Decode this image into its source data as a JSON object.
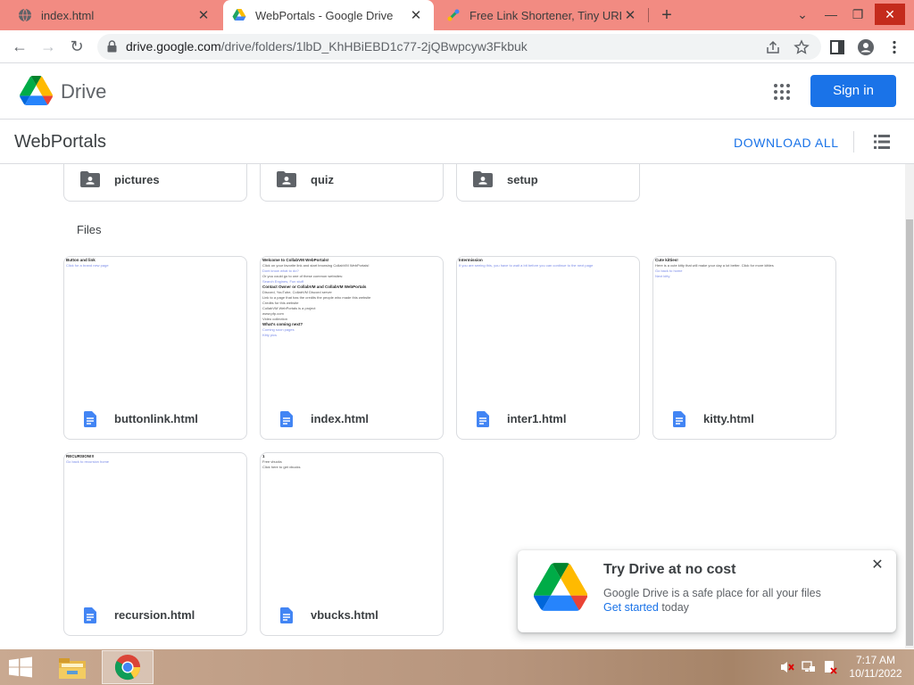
{
  "browser": {
    "tabs": [
      {
        "title": "index.html",
        "icon": "globe-icon",
        "active": false
      },
      {
        "title": "WebPortals - Google Drive",
        "icon": "drive-icon",
        "active": true
      },
      {
        "title": "Free Link Shortener, Tiny URL - n",
        "icon": "tinyurl-icon",
        "active": false
      }
    ],
    "new_tab": "+",
    "url_host": "drive.google.com",
    "url_path": "/drive/folders/1lbD_KhHBiEBD1c77-2jQBwpcyw3Fkbuk",
    "tab_close_glyph": "✕"
  },
  "drive": {
    "app_name": "Drive",
    "sign_in_label": "Sign in",
    "folder_title": "WebPortals",
    "download_all_label": "DOWNLOAD ALL",
    "files_section_label": "Files",
    "accent_color": "#1a73e8",
    "folders": [
      {
        "name": "pictures"
      },
      {
        "name": "quiz"
      },
      {
        "name": "setup"
      }
    ],
    "files": [
      {
        "name": "buttonlink.html",
        "preview": [
          {
            "t": "Button and link",
            "k": "h"
          },
          {
            "t": "Click for a brand new page",
            "k": "link"
          }
        ]
      },
      {
        "name": "index.html",
        "preview": [
          {
            "t": "Welcome to CollabVM WebPortals!",
            "k": "h"
          },
          {
            "t": "Click on your favorite link and start browsing CollabVM WebPortals!",
            "k": ""
          },
          {
            "t": "Dont know what to do?",
            "k": "link"
          },
          {
            "t": "Or you could go to one of these common websites:",
            "k": ""
          },
          {
            "t": "Search Engines, Fun stuff",
            "k": "link"
          },
          {
            "t": "Contact Owner or CollabVM and CollabVM WebPortals",
            "k": "h"
          },
          {
            "t": "Discord, YouTube, CollabVM Discord server",
            "k": ""
          },
          {
            "t": "Link to a page that has the credits the people who made this website",
            "k": ""
          },
          {
            "t": "Credits for this website",
            "k": ""
          },
          {
            "t": "CollabVM WebPortals is a project",
            "k": ""
          },
          {
            "t": "www.pfp.com",
            "k": ""
          },
          {
            "t": "Video collection",
            "k": ""
          },
          {
            "t": "What's coming next?",
            "k": "h"
          },
          {
            "t": "Coming soon pages",
            "k": "link"
          },
          {
            "t": "Kitty pics",
            "k": "link"
          }
        ]
      },
      {
        "name": "inter1.html",
        "preview": [
          {
            "t": "Intermission",
            "k": "h"
          },
          {
            "t": "If you are seeing this, you have to wait a bit before you can continue to the next page",
            "k": "link"
          }
        ]
      },
      {
        "name": "kitty.html",
        "preview": [
          {
            "t": "Cute kitties!",
            "k": "h"
          },
          {
            "t": "Here is a cute kitty that will make your day a lot better. Click for more kitties",
            "k": ""
          },
          {
            "t": "Go back to home",
            "k": "link"
          },
          {
            "t": "Next kitty",
            "k": "link"
          }
        ]
      },
      {
        "name": "recursion.html",
        "preview": [
          {
            "t": "RECURSION!!!",
            "k": "h"
          },
          {
            "t": "Go back to recursion home",
            "k": "link"
          }
        ]
      },
      {
        "name": "vbucks.html",
        "preview": [
          {
            "t": "1",
            "k": "h"
          },
          {
            "t": "Free vbucks",
            "k": ""
          },
          {
            "t": "Click here to get vbucks",
            "k": ""
          }
        ]
      }
    ],
    "promo": {
      "title": "Try Drive at no cost",
      "body": "Google Drive is a safe place for all your files",
      "cta_link": "Get started",
      "cta_suffix": " today",
      "close_glyph": "✕"
    }
  },
  "taskbar": {
    "time": "7:17 AM",
    "date": "10/11/2022",
    "apps": [
      "file-explorer-icon",
      "chrome-icon"
    ],
    "tray": [
      "mute-icon",
      "network-icon",
      "action-center-icon"
    ]
  }
}
